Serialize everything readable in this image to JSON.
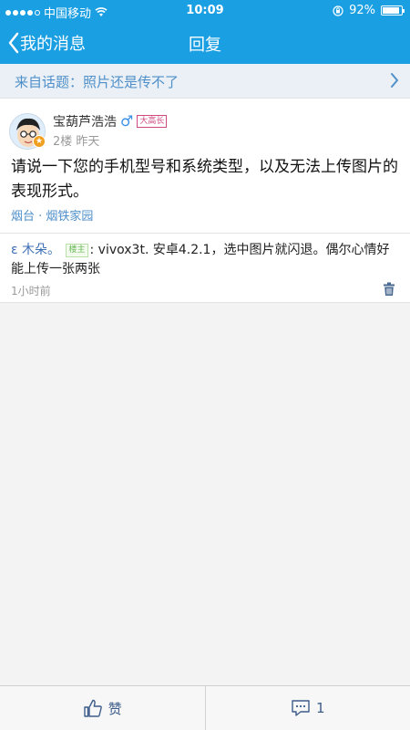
{
  "status_bar": {
    "carrier": "中国移动",
    "time": "10:09",
    "battery": "92%",
    "battery_level": 0.92
  },
  "nav": {
    "back_label": "我的消息",
    "title": "回复"
  },
  "topic": {
    "label": "来自话题：照片还是传不了"
  },
  "post": {
    "username": "宝葫芦浩浩",
    "gender_symbol": "♂",
    "rank": "大高长",
    "floor": "2楼",
    "time": "昨天",
    "body": "请说一下您的手机型号和系统类型，以及无法上传图片的表现形式。",
    "location": "烟台 · 烟铁家园"
  },
  "reply": {
    "author": "ε 木朵。",
    "op_tag": "楼主",
    "text": ": vivox3t.      安卓4.2.1，选中图片就闪退。偶尔心情好能上传一张两张",
    "time": "1小时前"
  },
  "bottom": {
    "like_label": "赞",
    "comment_count": "1"
  }
}
